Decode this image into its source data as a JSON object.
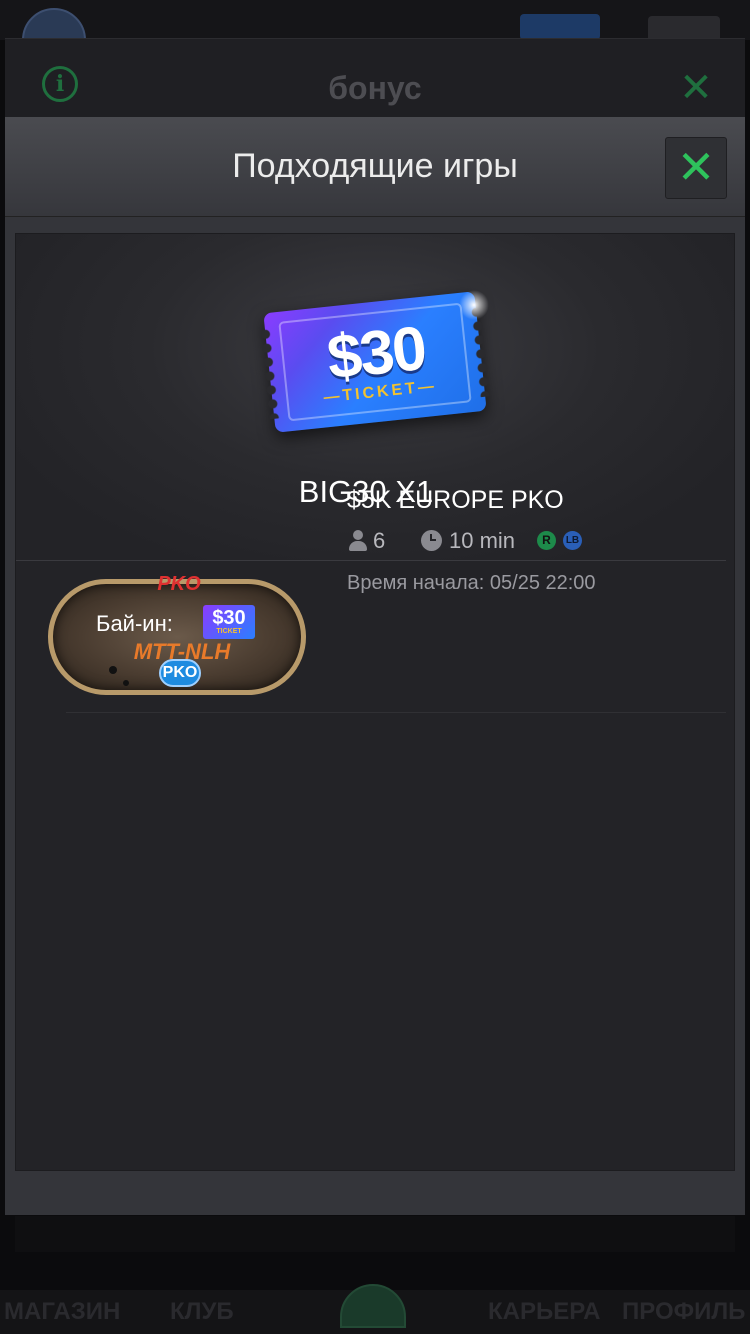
{
  "background": {
    "bonus_title": "бонус",
    "tabs": [
      "МАГАЗИН",
      "КЛУБ",
      "КАРЬЕРА",
      "ПРОФИЛЬ"
    ]
  },
  "modal": {
    "title": "Подходящие игры",
    "close_icon": "close-x-icon",
    "ticket": {
      "amount": "$30",
      "word": "TICKET"
    },
    "bonus_name": "BIG30 X1",
    "games": [
      {
        "table_label_top": "PKO",
        "buyin_label": "Бай-ин:",
        "buyin_ticket": "$30",
        "buyin_ticket_word": "TICKET",
        "game_type": "MTT-NLH",
        "badge": "PKO",
        "name": "$5K EUROPE PKO",
        "players": "6",
        "duration": "10 min",
        "r_badge": "R",
        "lb_badge": "LB",
        "start_time": "Время начала: 05/25 22:00"
      }
    ]
  },
  "colors": {
    "accent_green": "#2ec25c",
    "modal_bg": "#232327",
    "header_bg": "#4a4b50",
    "ticket_purple": "#8a3cff",
    "ticket_blue": "#2a7fff",
    "ticket_gold": "#f2c230"
  }
}
